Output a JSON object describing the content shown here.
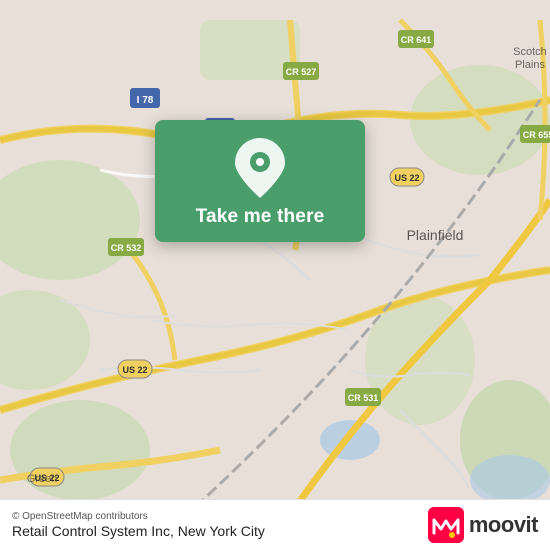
{
  "map": {
    "background_color": "#e8e0d8",
    "alt": "Map of New Jersey area near Plainfield"
  },
  "popup": {
    "label": "Take me there",
    "background_color": "#4a9e6b",
    "pin_icon": "location-pin"
  },
  "bottom_bar": {
    "attribution": "© OpenStreetMap contributors",
    "location_text": "Retail Control System Inc, New York City",
    "moovit_logo_text": "moovit"
  }
}
